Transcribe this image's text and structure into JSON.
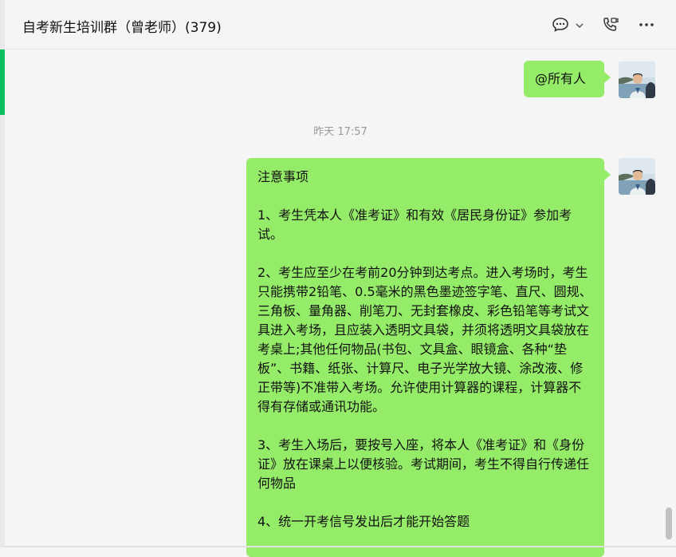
{
  "header": {
    "title": "自考新生培训群（曾老师）(379)"
  },
  "messages": [
    {
      "type": "outgoing",
      "text": "@所有人"
    },
    {
      "type": "timestamp",
      "text": "昨天 17:57"
    },
    {
      "type": "outgoing",
      "text": "注意事项\n\n1、考生凭本人《准考证》和有效《居民身份证》参加考试。\n\n2、考生应至少在考前20分钟到达考点。进入考场时，考生只能携带2铅笔、0.5毫米的黑色墨迹签字笔、直尺、圆规、三角板、量角器、削笔刀、无封套橡皮、彩色铅笔等考试文具进入考场，且应装入透明文具袋，并须将透明文具袋放在考桌上;其他任何物品(书包、文具盒、眼镜盒、各种“垫板”、书籍、纸张、计算尺、电子光学放大镜、涂改液、修正带等)不准带入考场。允许使用计算器的课程，计算器不得有存储或通讯功能。\n\n3、考生入场后，要按号入座，将本人《准考证》和《身份证》放在课桌上以便核验。考试期间，考生不得自行传递任何物品\n\n4、统一开考信号发出后才能开始答题"
    }
  ],
  "icons": {
    "chat": "chat-bubble-icon",
    "chevron": "chevron-down-icon",
    "call": "video-call-icon",
    "more": "more-options-icon",
    "avatar": "avatar-photo"
  },
  "colors": {
    "bubble_outgoing": "#95ec69",
    "accent": "#07c160",
    "background": "#f5f5f5"
  }
}
